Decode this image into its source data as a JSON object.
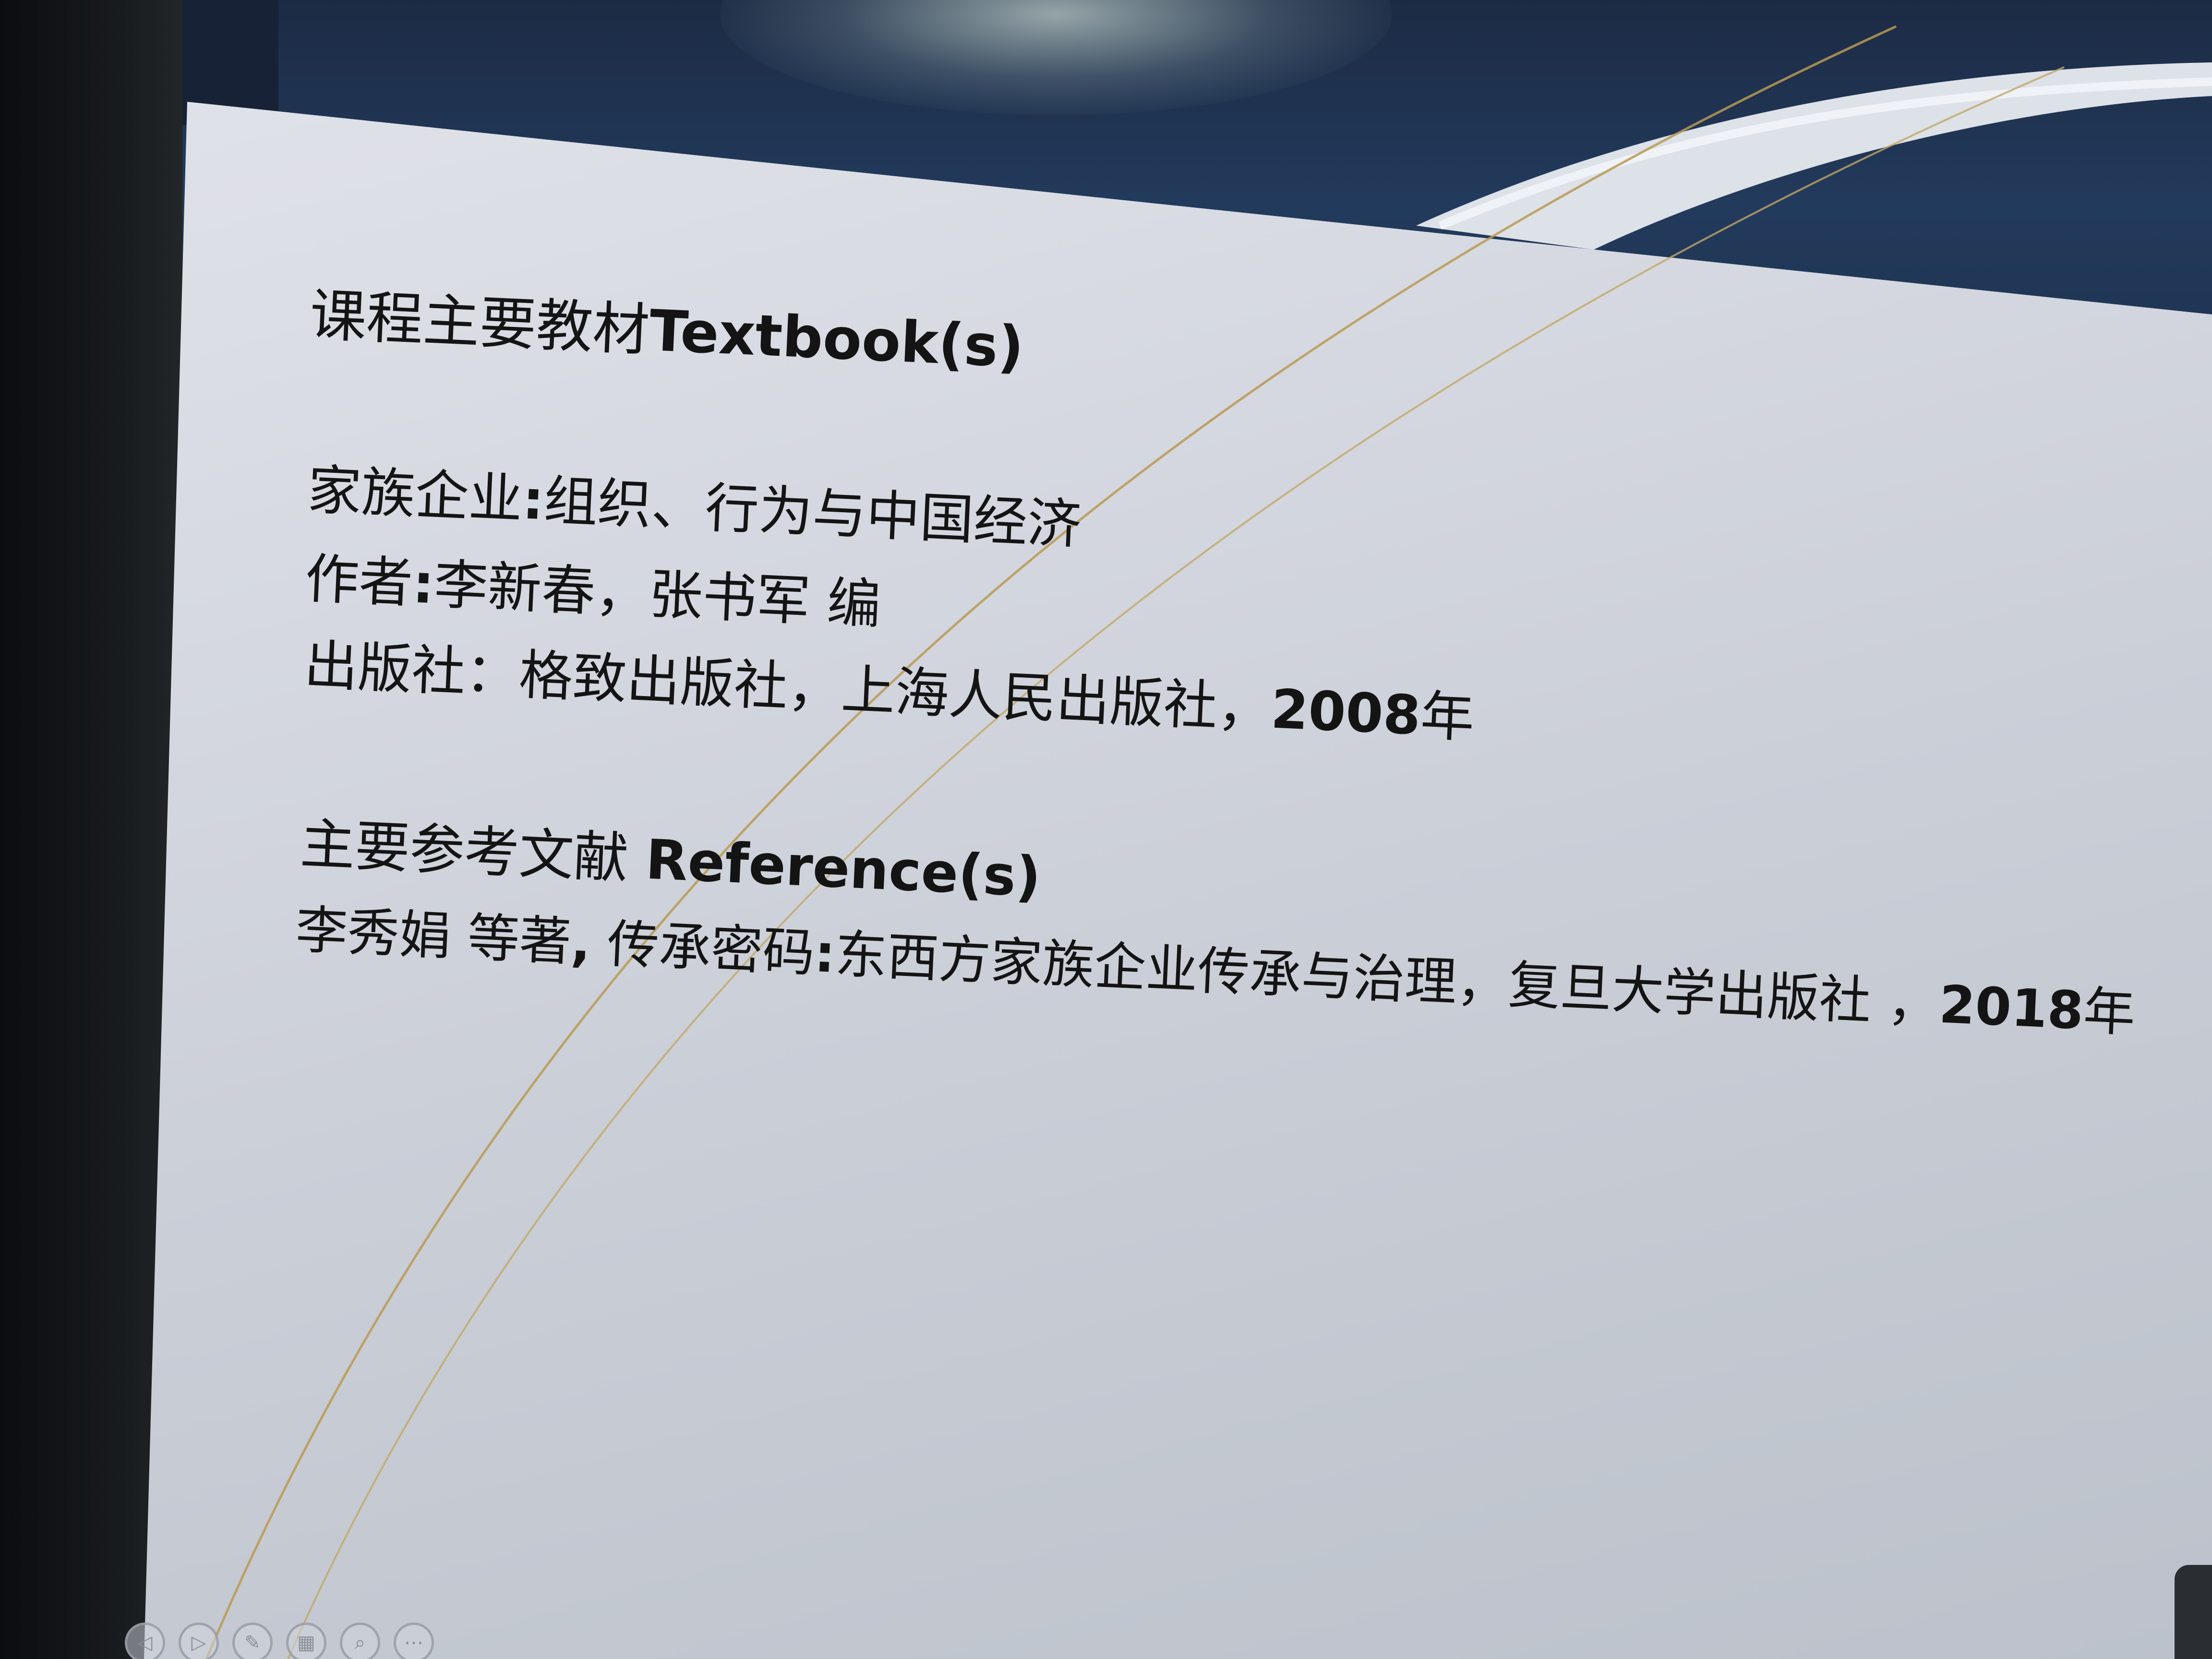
{
  "slide": {
    "textbook_heading": {
      "cn": "课程主要教材",
      "en": "Textbook(s)"
    },
    "book_title": {
      "label": "家族企业",
      "colon": ":",
      "title": "组织、行为与中国经济"
    },
    "authors": {
      "label": "作者",
      "colon": ":",
      "names": "李新春，张书军 编"
    },
    "publisher": {
      "label": "出版社：格致出版社，上海人民出版社，",
      "year": "2008",
      "year_suffix": "年"
    },
    "reference_heading": {
      "cn": "主要参考文献 ",
      "en": "Reference(s)"
    },
    "reference_entry": {
      "authors": "李秀娟 等著",
      "comma": ",",
      "title_part": " 传承密码",
      "colon": ":",
      "rest": "东西方家族企业传承与治理，复旦大学出版社 ，",
      "year": "2018",
      "year_suffix": "年"
    }
  },
  "nav_buttons": [
    {
      "icon": "previous-arrow-icon",
      "glyph": "◁"
    },
    {
      "icon": "next-arrow-icon",
      "glyph": "▷"
    },
    {
      "icon": "pen-icon",
      "glyph": "✎"
    },
    {
      "icon": "slides-grid-icon",
      "glyph": "▦"
    },
    {
      "icon": "zoom-icon",
      "glyph": "⌕"
    },
    {
      "icon": "more-options-icon",
      "glyph": "⋯"
    }
  ],
  "colors": {
    "header_navy": "#223a5c",
    "slide_background": "#d6d9e1",
    "arc_gold": "#b89a54",
    "text": "#141414"
  }
}
